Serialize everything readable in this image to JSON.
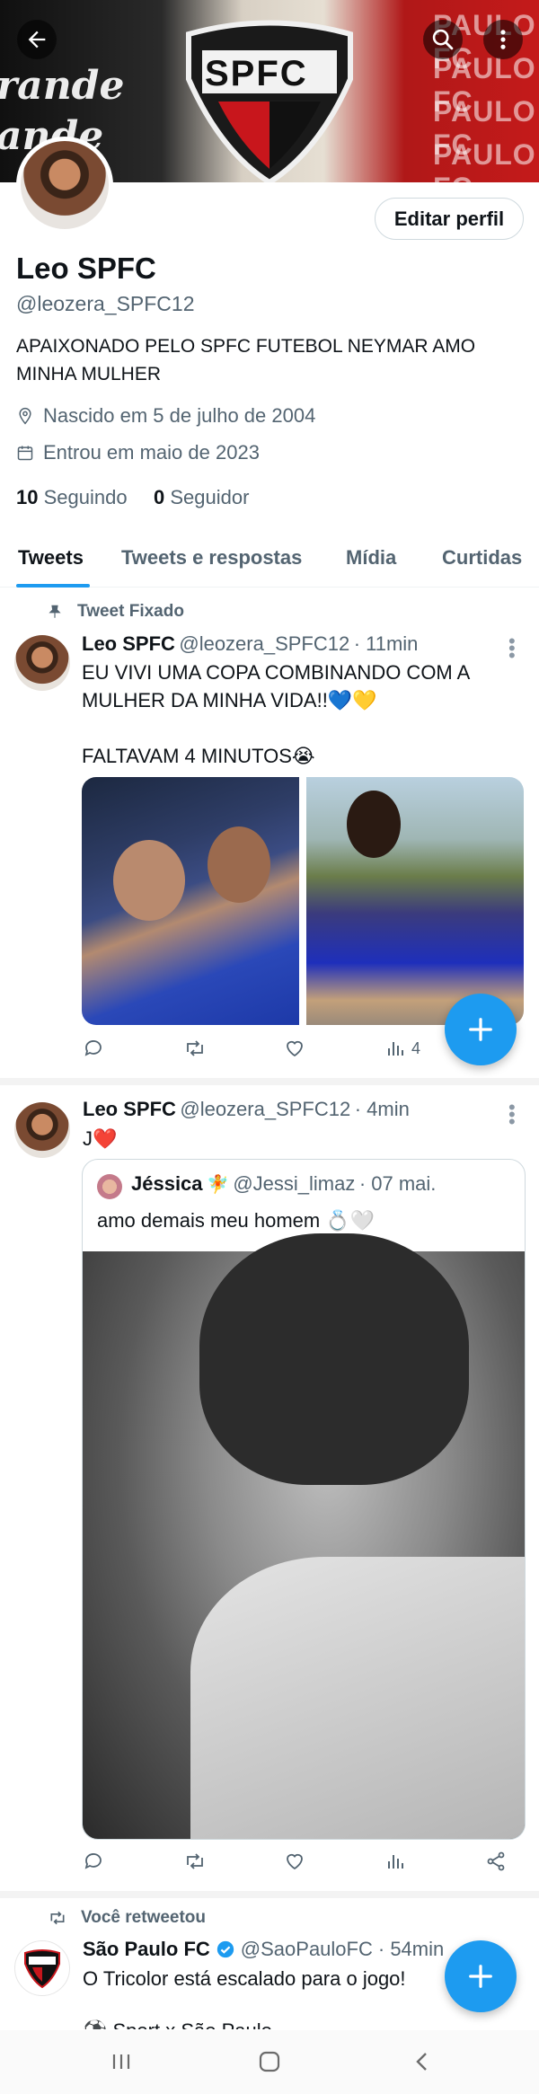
{
  "header": {
    "banner_text_1": "rande",
    "banner_text_2": "ande",
    "banner_badge": "SPFC",
    "banner_paulo": "PAULO FC"
  },
  "profile": {
    "name": "Leo SPFC",
    "handle": "@leozera_SPFC12",
    "edit_button": "Editar perfil",
    "bio": "APAIXONADO PELO SPFC FUTEBOL  NEYMAR AMO MINHA MULHER",
    "birth": "Nascido em 5 de julho de 2004",
    "joined": "Entrou em maio de 2023",
    "following_count": "10",
    "following_label": "Seguindo",
    "followers_count": "0",
    "followers_label": "Seguidor"
  },
  "tabs": [
    "Tweets",
    "Tweets e respostas",
    "Mídia",
    "Curtidas"
  ],
  "tweets": [
    {
      "context": "Tweet Fixado",
      "name": "Leo SPFC",
      "handle": "@leozera_SPFC12",
      "time": "· 11min",
      "text_1": "EU VIVI UMA COPA COMBINANDO COM A MULHER DA MINHA VIDA!!💙💛",
      "text_2": "FALTAVAM 4 MINUTOS😭",
      "views": "4"
    },
    {
      "name": "Leo SPFC",
      "handle": "@leozera_SPFC12",
      "time": "· 4min",
      "text": "J❤️",
      "quote": {
        "name": "Jéssica",
        "emoji": "🧚",
        "handle": "@Jessi_limaz",
        "time": "· 07 mai.",
        "text": "amo demais meu homem 💍🤍"
      }
    },
    {
      "context": "Você retweetou",
      "name": "São Paulo FC",
      "handle": "@SaoPauloFC",
      "time": "· 54min",
      "text": "O Tricolor está escalado para o jogo!",
      "text_cut": "⚽ Sport x São Paulo"
    }
  ],
  "colors": {
    "accent": "#1d9bf0",
    "text": "#0f1419",
    "muted": "#536471"
  }
}
